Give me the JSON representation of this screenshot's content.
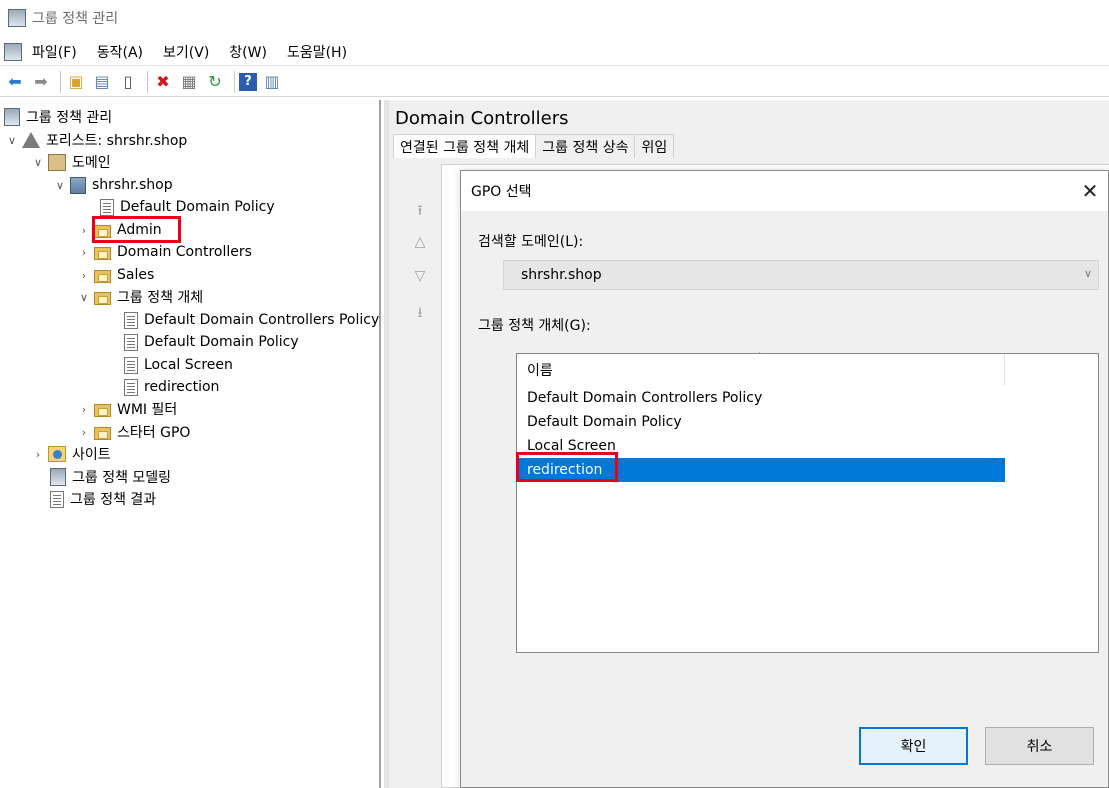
{
  "window": {
    "title": "그룹 정책 관리"
  },
  "menu": [
    "파일(F)",
    "동작(A)",
    "보기(V)",
    "창(W)",
    "도움말(H)"
  ],
  "toolbar": {
    "icons": [
      "back-icon",
      "forward-icon",
      "up-folder-icon",
      "show-hide-tree-icon",
      "clipboard-icon",
      "delete-icon",
      "properties-icon",
      "refresh-icon",
      "help-icon",
      "view-icon"
    ]
  },
  "tree": {
    "root": "그룹 정책 관리",
    "forest": "포리스트: shrshr.shop",
    "domains": "도메인",
    "domain": "shrshr.shop",
    "default_domain_policy": "Default Domain Policy",
    "admin": "Admin",
    "domain_controllers": "Domain Controllers",
    "sales": "Sales",
    "gpo_container": "그룹 정책 개체",
    "gpos": [
      "Default Domain Controllers Policy",
      "Default Domain Policy",
      "Local Screen",
      "redirection"
    ],
    "wmi": "WMI 필터",
    "starter": "스타터 GPO",
    "sites": "사이트",
    "modeling": "그룹 정책 모델링",
    "results": "그룹 정책 결과"
  },
  "right_pane": {
    "title": "Domain Controllers",
    "tabs": [
      "연결된 그룹 정책 개체",
      "그룹 정책 상속",
      "위임"
    ]
  },
  "dialog": {
    "title": "GPO 선택",
    "domain_label": "검색할 도메인(L):",
    "domain_value": "shrshr.shop",
    "gpo_label": "그룹 정책 개체(G):",
    "column_name": "이름",
    "items": [
      "Default Domain Controllers Policy",
      "Default Domain Policy",
      "Local Screen",
      "redirection"
    ],
    "selected_index": 3,
    "ok_label": "확인",
    "cancel_label": "취소"
  },
  "colors": {
    "selection": "#0078d7",
    "highlight_box": "#e8001c"
  }
}
